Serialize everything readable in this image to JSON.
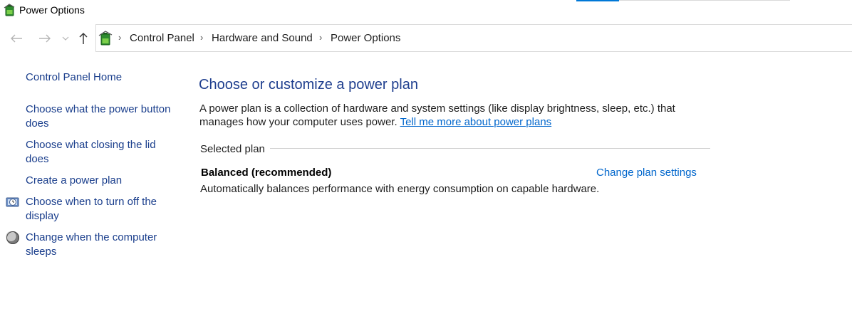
{
  "window": {
    "title": "Power Options",
    "icon": "power-options-battery-icon"
  },
  "navigation": {
    "back_icon": "back-arrow-icon",
    "forward_icon": "forward-arrow-icon",
    "recent_icon": "chevron-down-icon",
    "up_icon": "up-arrow-icon"
  },
  "address": {
    "icon": "control-panel-battery-icon",
    "breadcrumbs": [
      "Control Panel",
      "Hardware and Sound",
      "Power Options"
    ],
    "separator": "›"
  },
  "sidebar": {
    "home_link": "Control Panel Home",
    "items": [
      {
        "label_line1": "Choose what the power button",
        "label_line2": "does"
      },
      {
        "label_line1": "Choose what closing the lid",
        "label_line2": "does"
      },
      {
        "label_line1": "Create a power plan"
      },
      {
        "label_line1": "Choose when to turn off the",
        "label_line2": "display",
        "icon": "monitor-clock-icon"
      },
      {
        "label_line1": "Change when the computer",
        "label_line2": "sleeps",
        "icon": "moon-sleep-icon"
      }
    ]
  },
  "main": {
    "heading": "Choose or customize a power plan",
    "description_line1": "A power plan is a collection of hardware and system settings (like display brightness, sleep, etc.) that",
    "description_line2_text": "manages how your computer uses power.",
    "description_link": "Tell me more about power plans",
    "group_label": "Selected plan",
    "plan": {
      "name": "Balanced (recommended)",
      "change_link": "Change plan settings",
      "description": "Automatically balances performance with energy consumption on capable hardware."
    }
  },
  "colors": {
    "link": "#1a3e8c",
    "heading": "#1e3e8e",
    "hyperlink": "#0066cc",
    "accent": "#0078d7"
  }
}
